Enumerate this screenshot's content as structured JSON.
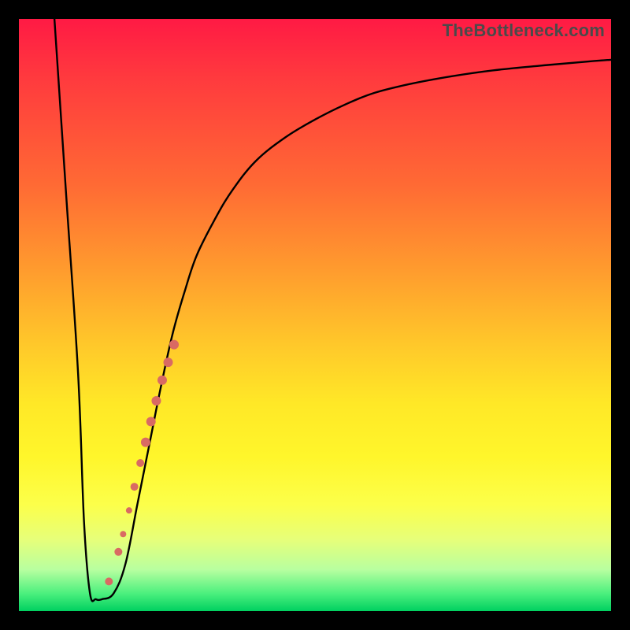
{
  "watermark": "TheBottleneck.com",
  "chart_data": {
    "type": "line",
    "title": "",
    "xlabel": "",
    "ylabel": "",
    "xlim": [
      0,
      100
    ],
    "ylim": [
      0,
      100
    ],
    "series": [
      {
        "name": "bottleneck-curve",
        "x": [
          6,
          8,
          10,
          11,
          12,
          13,
          14,
          16,
          18,
          20,
          22,
          24,
          26,
          28,
          30,
          33,
          36,
          40,
          45,
          50,
          55,
          60,
          66,
          73,
          80,
          88,
          96,
          100
        ],
        "y": [
          100,
          70,
          40,
          15,
          3,
          2,
          2,
          3,
          8,
          18,
          28,
          38,
          47,
          54,
          60,
          66,
          71,
          76,
          80,
          83,
          85.5,
          87.5,
          89,
          90.3,
          91.3,
          92.1,
          92.8,
          93.1
        ]
      }
    ],
    "markers": [
      {
        "name": "highlight-dots",
        "x": 15.2,
        "y": 5,
        "r": 5
      },
      {
        "name": "highlight-dots",
        "x": 16.8,
        "y": 10,
        "r": 5
      },
      {
        "name": "highlight-dots",
        "x": 17.6,
        "y": 13,
        "r": 4
      },
      {
        "name": "highlight-dots",
        "x": 18.6,
        "y": 17,
        "r": 4
      },
      {
        "name": "highlight-dots",
        "x": 19.5,
        "y": 21,
        "r": 5
      },
      {
        "name": "highlight-dots",
        "x": 20.5,
        "y": 25,
        "r": 5
      },
      {
        "name": "highlight-dots",
        "x": 21.4,
        "y": 28.5,
        "r": 6
      },
      {
        "name": "highlight-dots",
        "x": 22.3,
        "y": 32,
        "r": 6
      },
      {
        "name": "highlight-dots",
        "x": 23.2,
        "y": 35.5,
        "r": 6
      },
      {
        "name": "highlight-dots",
        "x": 24.2,
        "y": 39,
        "r": 6
      },
      {
        "name": "highlight-dots",
        "x": 25.2,
        "y": 42,
        "r": 6
      },
      {
        "name": "highlight-dots",
        "x": 26.2,
        "y": 45,
        "r": 6
      }
    ],
    "colors": {
      "curve": "#000000",
      "markers": "#d96a63"
    }
  }
}
